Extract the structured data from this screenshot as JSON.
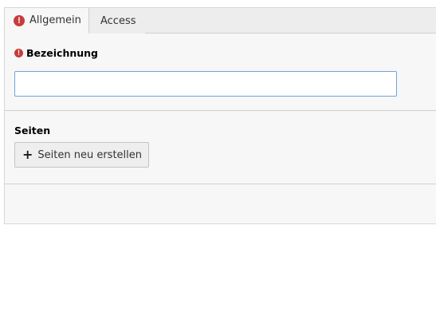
{
  "tabs": [
    {
      "label": "Allgemein",
      "has_error": true,
      "active": true
    },
    {
      "label": "Access",
      "has_error": false,
      "active": false
    }
  ],
  "general": {
    "title_field": {
      "label": "Bezeichnung",
      "required_icon": "exclamation-circle-icon",
      "value": "",
      "placeholder": ""
    },
    "pages": {
      "label": "Seiten",
      "add_button_label": "Seiten neu erstellen",
      "add_button_icon": "plus-icon"
    }
  },
  "colors": {
    "error": "#c83c3c",
    "input_focus_border": "#6fa2d8",
    "panel_bg": "#f7f7f7",
    "tabbar_bg": "#ededed"
  }
}
